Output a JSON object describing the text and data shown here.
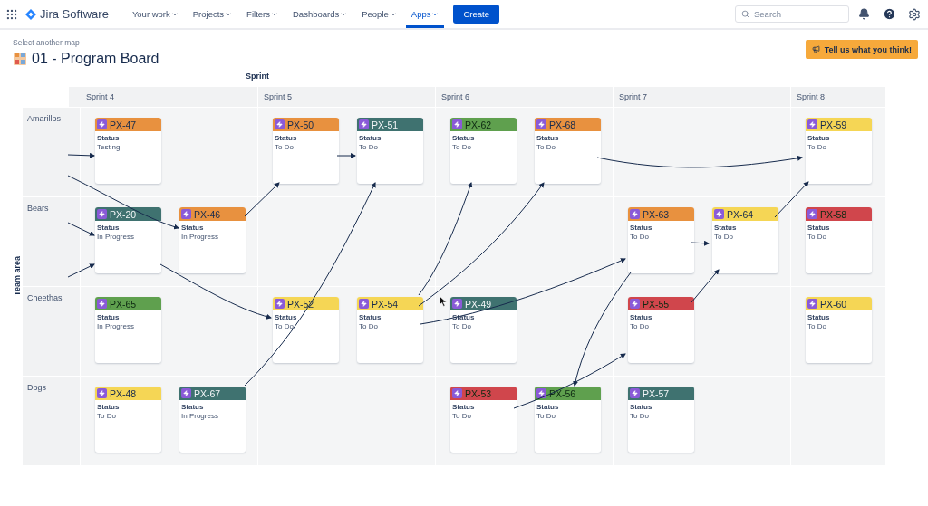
{
  "nav": {
    "product": "Jira Software",
    "items": [
      {
        "label": "Your work",
        "selected": false
      },
      {
        "label": "Projects",
        "selected": false
      },
      {
        "label": "Filters",
        "selected": false
      },
      {
        "label": "Dashboards",
        "selected": false
      },
      {
        "label": "People",
        "selected": false
      },
      {
        "label": "Apps",
        "selected": true
      }
    ],
    "create": "Create",
    "search": {
      "placeholder": "Search"
    }
  },
  "header": {
    "breadcrumb": "Select another map",
    "title": "01 - Program Board",
    "feedback": "Tell us what you think!"
  },
  "board": {
    "column_axis": "Sprint",
    "row_axis": "Team area",
    "sprints": [
      "Sprint 4",
      "Sprint 5",
      "Sprint 6",
      "Sprint 7",
      "Sprint 8"
    ],
    "teams": [
      {
        "name": "Amarillos",
        "cells": [
          {
            "cards": [
              {
                "key": "PX-47",
                "color": "#e8913f",
                "field": "Status",
                "status": "Testing"
              }
            ]
          },
          {
            "cards": [
              {
                "key": "PX-50",
                "color": "#e8913f",
                "field": "Status",
                "status": "To Do"
              },
              {
                "key": "PX-51",
                "color": "#3f7270",
                "field": "Status",
                "status": "To Do"
              }
            ]
          },
          {
            "cards": [
              {
                "key": "PX-62",
                "color": "#5fa04e",
                "field": "Status",
                "status": "To Do"
              },
              {
                "key": "PX-68",
                "color": "#e8913f",
                "field": "Status",
                "status": "To Do"
              }
            ]
          },
          {},
          {
            "cards": [
              {
                "key": "PX-59",
                "color": "#f5d655",
                "field": "Status",
                "status": "To Do"
              }
            ]
          }
        ]
      },
      {
        "name": "Bears",
        "cells": [
          {
            "cards": [
              {
                "key": "PX-20",
                "color": "#3f7270",
                "field": "Status",
                "status": "In Progress"
              },
              {
                "key": "PX-46",
                "color": "#e8913f",
                "field": "Status",
                "status": "In Progress"
              }
            ]
          },
          {},
          {},
          {
            "cards": [
              {
                "key": "PX-63",
                "color": "#e8913f",
                "field": "Status",
                "status": "To Do"
              },
              {
                "key": "PX-64",
                "color": "#f5d655",
                "field": "Status",
                "status": "To Do"
              }
            ]
          },
          {
            "cards": [
              {
                "key": "PX-58",
                "color": "#d0464c",
                "field": "Status",
                "status": "To Do"
              }
            ]
          }
        ]
      },
      {
        "name": "Cheethas",
        "cells": [
          {
            "cards": [
              {
                "key": "PX-65",
                "color": "#5fa04e",
                "field": "Status",
                "status": "In Progress"
              }
            ]
          },
          {
            "cards": [
              {
                "key": "PX-52",
                "color": "#f5d655",
                "field": "Status",
                "status": "To Do"
              },
              {
                "key": "PX-54",
                "color": "#f5d655",
                "field": "Status",
                "status": "To Do"
              }
            ]
          },
          {
            "cards": [
              {
                "key": "PX-49",
                "color": "#3f7270",
                "field": "Status",
                "status": "To Do"
              }
            ]
          },
          {
            "cards": [
              {
                "key": "PX-55",
                "color": "#d0464c",
                "field": "Status",
                "status": "To Do"
              }
            ]
          },
          {
            "cards": [
              {
                "key": "PX-60",
                "color": "#f5d655",
                "field": "Status",
                "status": "To Do"
              }
            ]
          }
        ]
      },
      {
        "name": "Dogs",
        "cells": [
          {
            "cards": [
              {
                "key": "PX-48",
                "color": "#f5d655",
                "field": "Status",
                "status": "To Do"
              },
              {
                "key": "PX-67",
                "color": "#3f7270",
                "field": "Status",
                "status": "In Progress"
              }
            ]
          },
          {},
          {
            "cards": [
              {
                "key": "PX-53",
                "color": "#d0464c",
                "field": "Status",
                "status": "To Do"
              },
              {
                "key": "PX-56",
                "color": "#5fa04e",
                "field": "Status",
                "status": "To Do"
              }
            ]
          },
          {
            "cards": [
              {
                "key": "PX-57",
                "color": "#3f7270",
                "field": "Status",
                "status": "To Do"
              }
            ]
          },
          {}
        ]
      }
    ]
  }
}
